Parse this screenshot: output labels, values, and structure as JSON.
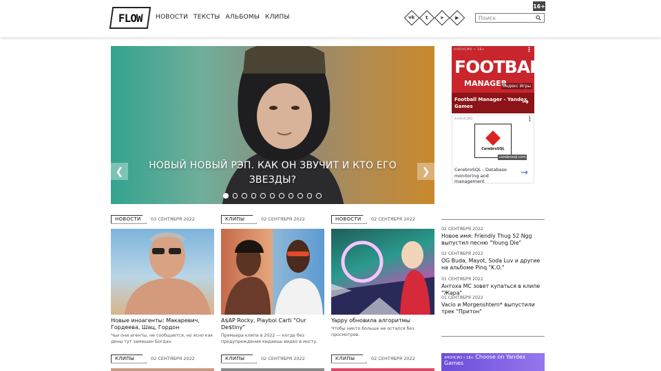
{
  "header": {
    "logo": "FLOW",
    "nav": [
      "НОВОСТИ",
      "ТЕКСТЫ",
      "АЛЬБОМЫ",
      "КЛИПЫ"
    ],
    "social": [
      {
        "name": "vk-icon",
        "glyph": "vk"
      },
      {
        "name": "twitter-icon",
        "glyph": "t"
      },
      {
        "name": "telegram-icon",
        "glyph": "➤"
      },
      {
        "name": "youtube-icon",
        "glyph": "▶"
      }
    ],
    "search_placeholder": "Поиск",
    "age_badge": "16+"
  },
  "hero": {
    "title": "НОВЫЙ НОВЫЙ РЭП. КАК ОН ЗВУЧИТ И КТО ЕГО ЗВЕЗДЫ?",
    "dot_count": 11,
    "active_dot": 0
  },
  "ads": {
    "ad1": {
      "label": "АНОНСИО • 18+",
      "big": "FOOTBALL",
      "small": "MANAGER",
      "brand": "Яндекс Игры",
      "caption": "Football Manager - Yandex Games"
    },
    "ad2": {
      "label": "АНОНСИО",
      "logo_text": "CerebroSQL",
      "domain": "cerebrosql.com",
      "caption": "CerebroSQL - Database monitoring and management"
    },
    "ad3": {
      "label": "АНОНСИО • 18+",
      "caption": "Choose on Yandex Games"
    }
  },
  "cards": [
    {
      "tag": "НОВОСТИ",
      "date": "03 СЕНТЯБРЯ 2022",
      "title": "Новые иноагенты: Макаревич, Гордеева, Шац, Гордон",
      "desc": "Чьи они агенты, не сообщается, но ясно как дены тут замешан Богдан"
    },
    {
      "tag": "КЛИПЫ",
      "date": "02 СЕНТЯБРЯ 2022",
      "title": "A$AP Rocky, Playboi Carti \"Our De$tiny\"",
      "desc": "Премьера клипа в 2022 — когда без предупреждения кидаешь видео в инсту."
    },
    {
      "tag": "НОВОСТИ",
      "date": "02 СЕНТЯБРЯ 2022",
      "title": "Yappy обновила алгоритмы",
      "desc": "Чтобы никто больше не остался без просмотров."
    },
    {
      "tag": "КЛИПЫ",
      "date": "02 СЕНТЯБРЯ 2022"
    },
    {
      "tag": "КЛИПЫ",
      "date": "02 СЕНТЯБРЯ 2022"
    },
    {
      "tag": "КЛИПЫ",
      "date": "02 СЕНТЯБРЯ 2022"
    }
  ],
  "side_news": [
    {
      "date": "02 СЕНТЯБРЯ 2022",
      "title": "Новое имя: Friendly Thug 52 Ngg выпустил песню \"Young Die\""
    },
    {
      "date": "02 СЕНТЯБРЯ 2022",
      "title": "OG Buda, Mayot, Soda Luv и другие на альбоме Pinq \"K.O.\""
    },
    {
      "date": "01 СЕНТЯБРЯ 2022",
      "title": "Антоха МС зовет купаться в клипе \"Жара\""
    },
    {
      "date": "01 СЕНТЯБРЯ 2022",
      "title": "Vacio и Morgenshtern* выпустили трек \"Притон\""
    }
  ]
}
